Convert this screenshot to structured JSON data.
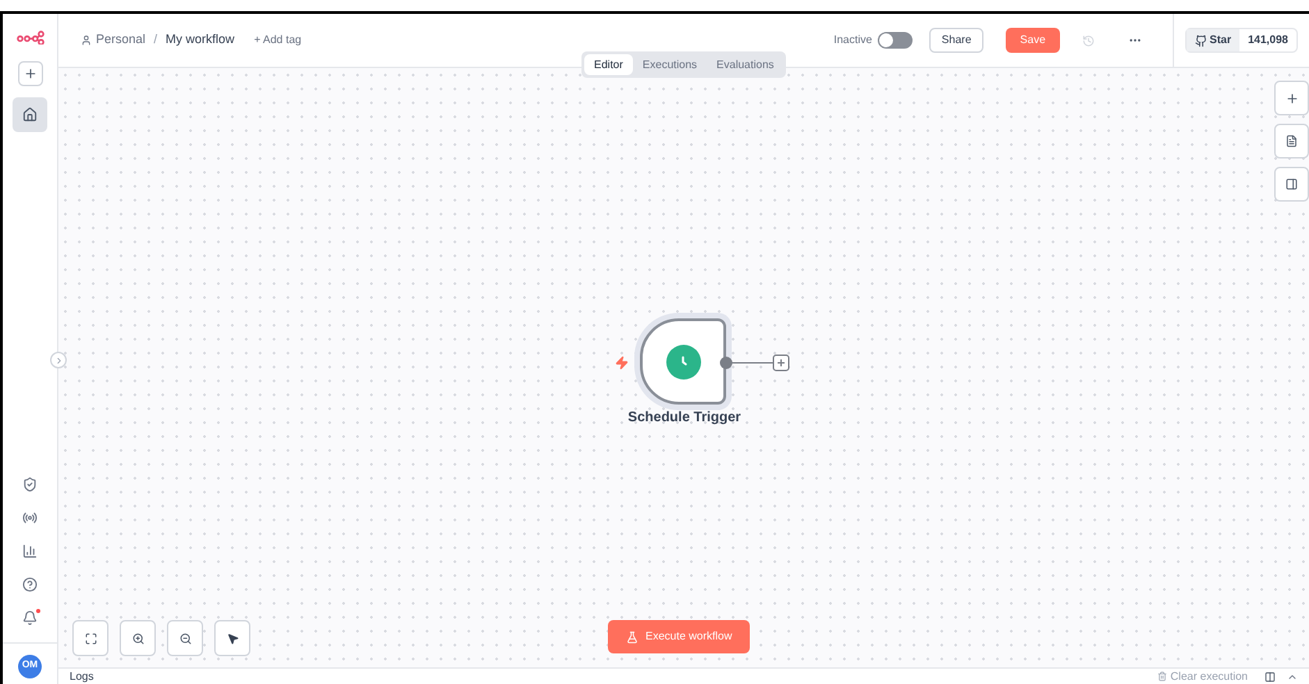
{
  "breadcrumb": {
    "project": "Personal",
    "separator": "/",
    "workflow": "My workflow",
    "add_tag": "+ Add tag"
  },
  "tabs": [
    {
      "label": "Editor",
      "selected": true
    },
    {
      "label": "Executions",
      "selected": false
    },
    {
      "label": "Evaluations",
      "selected": false
    }
  ],
  "active_toggle": {
    "label": "Inactive",
    "on": false
  },
  "share_button": "Share",
  "save_button": "Save",
  "github": {
    "label": "Star",
    "count": "141,098"
  },
  "node": {
    "name": "Schedule Trigger"
  },
  "execute_button": "Execute workflow",
  "avatar": {
    "initials": "OM"
  },
  "notifications": {
    "unread": true
  },
  "logs": {
    "title": "Logs",
    "clear": "Clear execution"
  }
}
